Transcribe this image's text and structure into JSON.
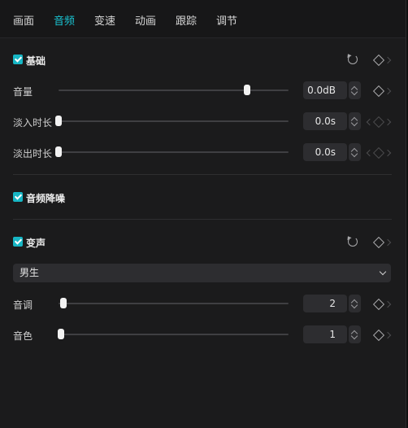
{
  "tabs": [
    "画面",
    "音频",
    "变速",
    "动画",
    "跟踪",
    "调节"
  ],
  "active_tab": "音频",
  "basic": {
    "title": "基础",
    "volume": {
      "label": "音量",
      "value": "0.0dB",
      "level": 0.82
    },
    "fade_in": {
      "label": "淡入时长",
      "value": "0.0s",
      "level": 0.0
    },
    "fade_out": {
      "label": "淡出时长",
      "value": "0.0s",
      "level": 0.0
    }
  },
  "denoise": {
    "title": "音频降噪"
  },
  "voice_change": {
    "title": "变声",
    "preset": "男生",
    "pitch": {
      "label": "音调",
      "value": "2",
      "level": 0.02
    },
    "timbre": {
      "label": "音色",
      "value": "1",
      "level": 0.01
    }
  },
  "colors": {
    "accent": "#19c4d2",
    "panel": "#1b1b1c"
  }
}
